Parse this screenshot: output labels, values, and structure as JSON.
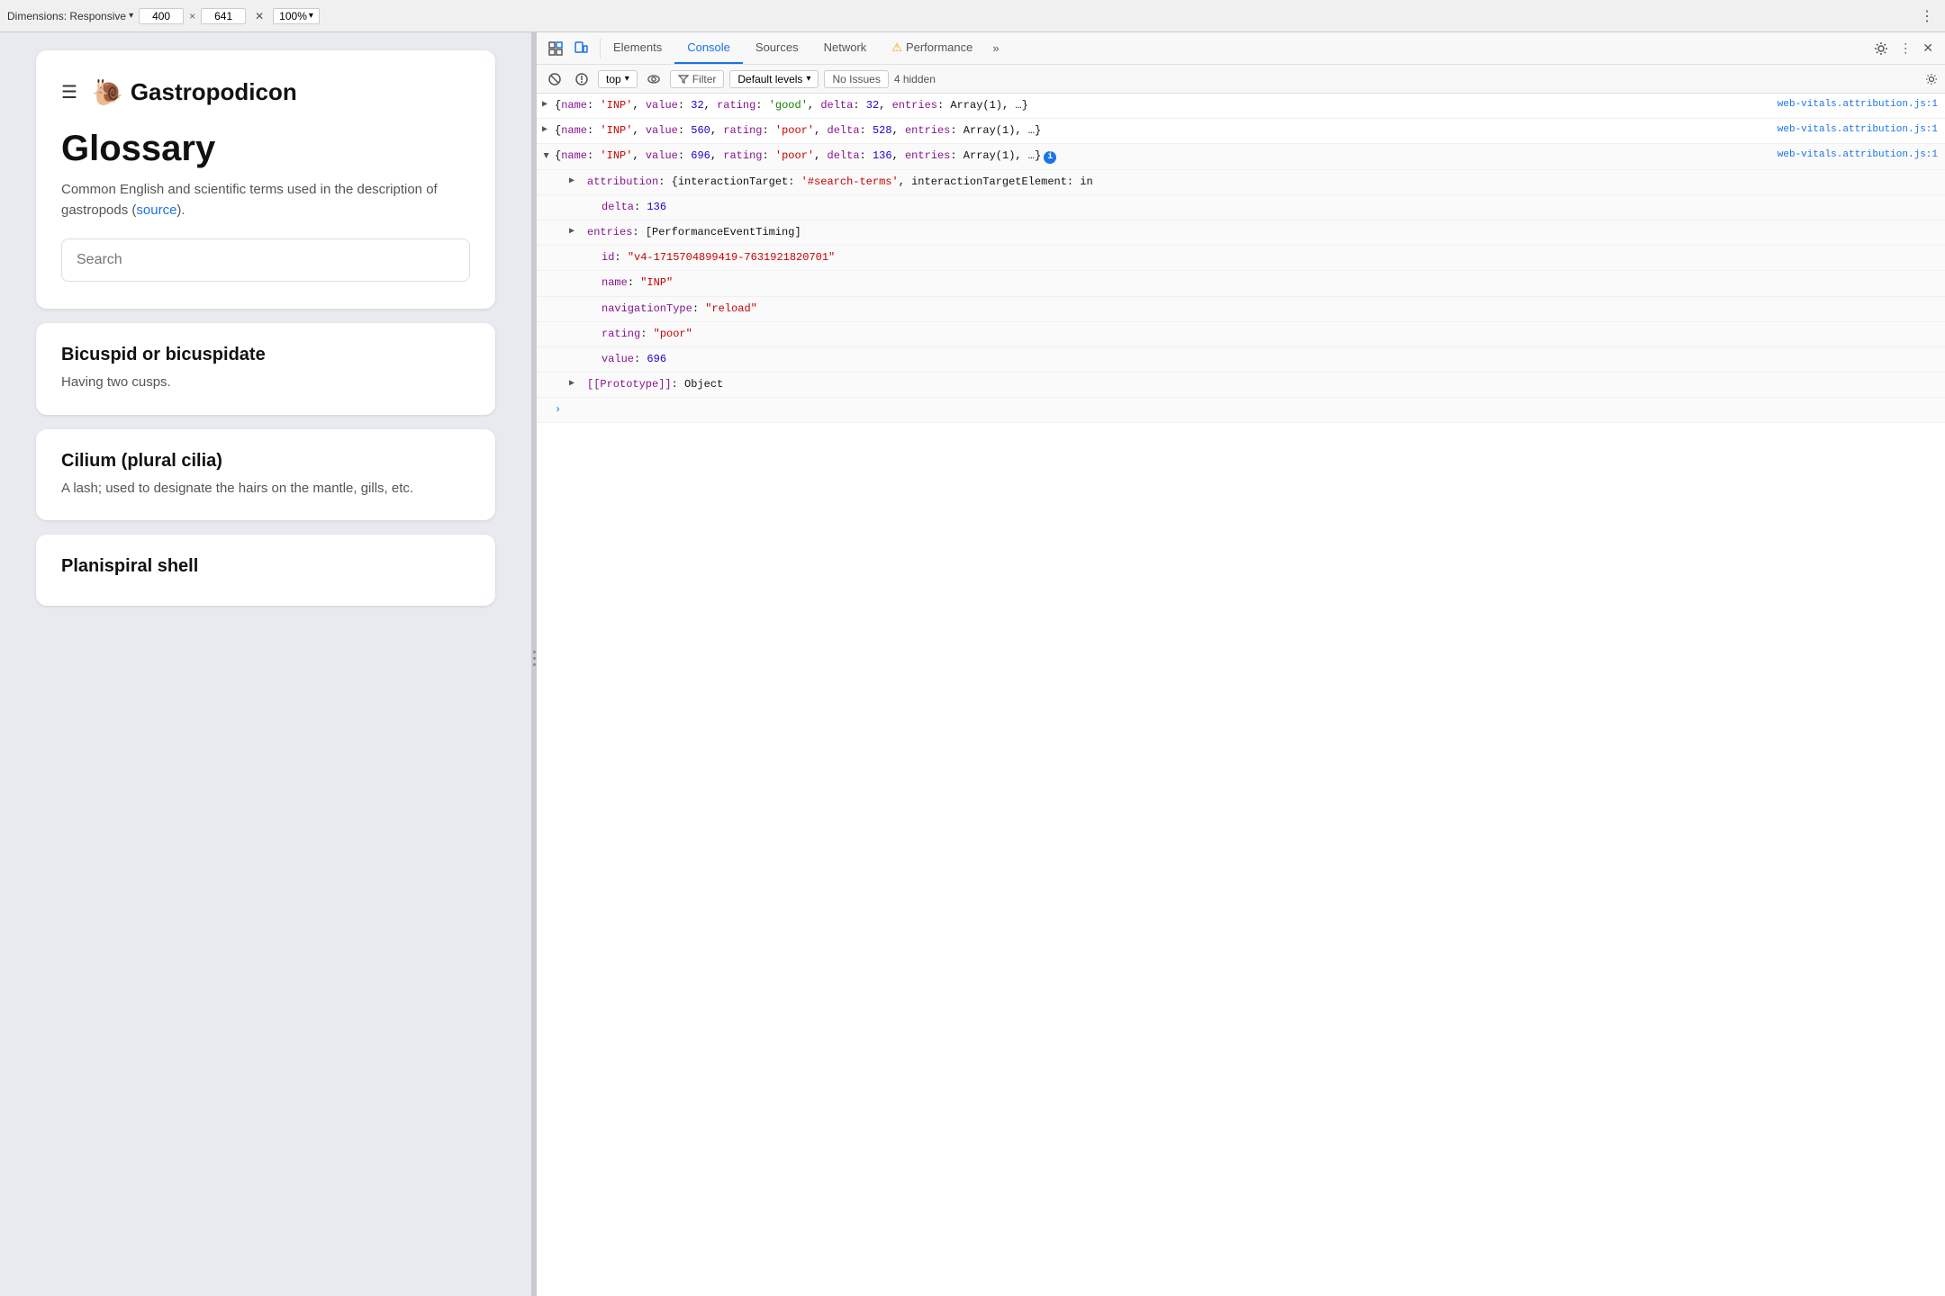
{
  "toolbar": {
    "dimensions_label": "Dimensions: Responsive",
    "width": "400",
    "height": "641",
    "zoom": "100%",
    "more_icon": "⋮"
  },
  "webpage": {
    "header": {
      "hamburger": "☰",
      "snail": "🐌",
      "title": "Gastropodicon"
    },
    "glossary": {
      "title": "Glossary",
      "description_prefix": "Common English and scientific terms used in the description of gastropods (",
      "source_link": "source",
      "description_suffix": ").",
      "search_placeholder": "Search"
    },
    "items": [
      {
        "term": "Bicuspid or bicuspidate",
        "definition": "Having two cusps."
      },
      {
        "term": "Cilium (plural cilia)",
        "definition": "A lash; used to designate the hairs on the mantle, gills, etc."
      },
      {
        "term": "Planispiral shell",
        "definition": ""
      }
    ]
  },
  "devtools": {
    "tabs": [
      {
        "id": "elements",
        "label": "Elements",
        "active": false
      },
      {
        "id": "console",
        "label": "Console",
        "active": true
      },
      {
        "id": "sources",
        "label": "Sources",
        "active": false
      },
      {
        "id": "network",
        "label": "Network",
        "active": false
      },
      {
        "id": "performance",
        "label": "Performance",
        "active": false
      }
    ],
    "more_tabs": "»",
    "console_toolbar": {
      "context": "top",
      "filter_label": "Filter",
      "levels_label": "Default levels",
      "no_issues": "No Issues",
      "hidden_count": "4 hidden"
    },
    "console_entries": [
      {
        "id": "entry1",
        "collapsed": true,
        "link": "web-vitals.attribution.js:1",
        "content": "{name: 'INP', value: 32, rating: 'good', delta: 32, entries: Array(1), …}"
      },
      {
        "id": "entry2",
        "collapsed": true,
        "link": "web-vitals.attribution.js:1",
        "content": "{name: 'INP', value: 560, rating: 'poor', delta: 528, entries: Array(1), …}"
      },
      {
        "id": "entry3",
        "collapsed": false,
        "link": "web-vitals.attribution.js:1",
        "content": "{name: 'INP', value: 696, rating: 'poor', delta: 136, entries: Array(1), …}",
        "has_info": true,
        "children": [
          {
            "key": "attribution",
            "value": "{interactionTarget: '#search-terms', interactionTargetElement: in",
            "indent": 1,
            "collapsed": true
          },
          {
            "key": "delta",
            "value": "136",
            "indent": 2,
            "type": "number"
          },
          {
            "key": "entries",
            "value": "[PerformanceEventTiming]",
            "indent": 1,
            "collapsed": true
          },
          {
            "key": "id",
            "value": "\"v4-1715704899419-7631921820701\"",
            "indent": 2,
            "type": "string",
            "no_key_colon": false
          },
          {
            "key": "name",
            "value": "\"INP\"",
            "indent": 2,
            "type": "string"
          },
          {
            "key": "navigationType",
            "value": "\"reload\"",
            "indent": 2,
            "type": "string"
          },
          {
            "key": "rating",
            "value": "\"poor\"",
            "indent": 2,
            "type": "string"
          },
          {
            "key": "value",
            "value": "696",
            "indent": 2,
            "type": "number"
          },
          {
            "key": "[[Prototype]]",
            "value": "Object",
            "indent": 1,
            "collapsed": true
          }
        ]
      }
    ],
    "console_input_placeholder": ""
  }
}
